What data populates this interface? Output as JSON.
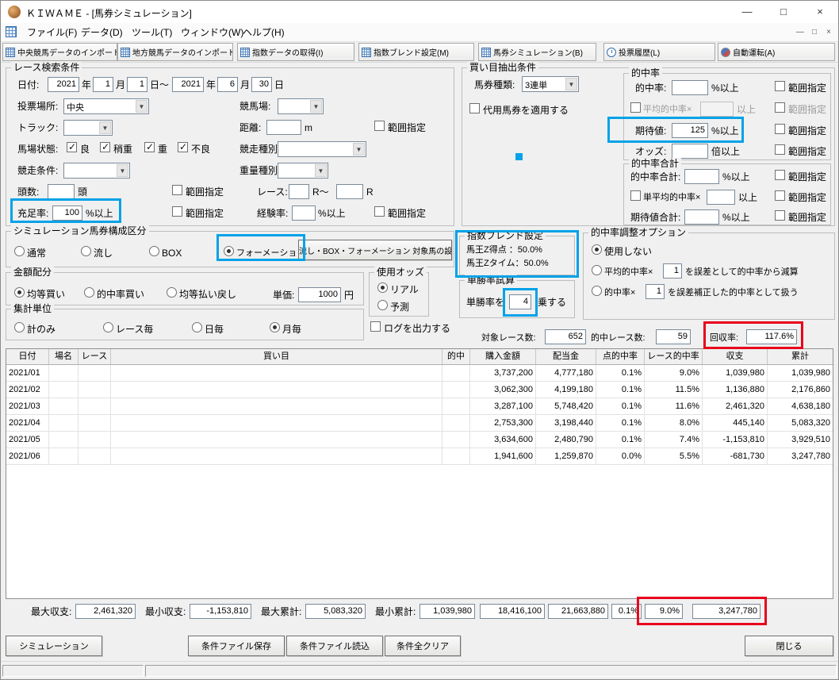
{
  "window": {
    "title": "ＫＩＷＡＭＥ - [馬券シミュレーション]",
    "minimize_glyph": "—",
    "maximize_glyph": "□",
    "close_glyph": "×"
  },
  "menu": {
    "file": "ファイル(F)",
    "data": "データ(D)",
    "tools": "ツール(T)",
    "window": "ウィンドウ(W)",
    "help": "ヘルプ(H)",
    "mdi_minimize": "—",
    "mdi_restore": "□",
    "mdi_close": "×"
  },
  "toolbar": {
    "central_import": "中央競馬データのインポート(J)",
    "local_import": "地方競馬データのインポート(N)",
    "index_fetch": "指数データの取得(I)",
    "index_blend": "指数ブレンド設定(M)",
    "simulation": "馬券シミュレーション(B)",
    "history": "投票履歴(L)",
    "autorun": "自動運転(A)"
  },
  "search": {
    "title": "レース検索条件",
    "date_label": "日付:",
    "from_year": "2021",
    "from_month": "1",
    "from_day": "1",
    "to_year": "2021",
    "to_month": "6",
    "to_day": "30",
    "year_unit": "年",
    "month_unit": "月",
    "day_range_unit": "日～",
    "day_unit": "日",
    "place_label": "投票場所:",
    "place_value": "中央",
    "course_label": "競馬場:",
    "track_label": "トラック:",
    "distance_label": "距離:",
    "distance_value": "",
    "distance_unit": "m",
    "range_label": "範囲指定",
    "going_label": "馬場状態:",
    "going_good": "良",
    "going_yielding": "稍重",
    "going_soft": "重",
    "going_heavy": "不良",
    "race_type_label": "競走種別:",
    "race_cond_label": "競走条件:",
    "weight_type_label": "重量種別:",
    "heads_label": "頭数:",
    "heads_value": "",
    "heads_unit": "頭",
    "race_no_label": "レース:",
    "race_no_from": "",
    "race_no_sep": "R～",
    "race_no_to": "",
    "race_no_unit": "R",
    "fill_label": "充足率:",
    "fill_value": "100",
    "fill_unit": "%以上",
    "exp_label": "経験率:",
    "exp_value": "",
    "exp_unit": "%以上"
  },
  "extract": {
    "title": "買い目抽出条件",
    "ticket_label": "馬券種類:",
    "ticket_value": "3連単",
    "substitute_label": "代用馬券を適用する",
    "hit_group": {
      "title": "的中率",
      "hit_label": "的中率:",
      "hit_value": "",
      "pct_unit": "%以上",
      "avg_label": "平均的中率×",
      "avg_value": "",
      "over_unit": "以上",
      "expect_label": "期待値:",
      "expect_value": "125",
      "odds_label": "オッズ:",
      "odds_value": "",
      "odds_unit": "倍以上",
      "range_label": "範囲指定"
    },
    "sum_group": {
      "title": "的中率合計",
      "hit_label": "的中率合計:",
      "hit_value": "",
      "avg_label": "単平均的中率×",
      "avg_value": "",
      "expect_label": "期待値合計:",
      "expect_value": "",
      "pct_unit": "%以上",
      "over_unit": "以上",
      "range_label": "範囲指定"
    }
  },
  "composition": {
    "title": "シミュレーション馬券構成区分",
    "normal": "通常",
    "nagashi": "流し",
    "box": "BOX",
    "formation": "フォーメーション",
    "selected": "フォーメーション",
    "target_button": "流し・BOX・フォーメーション 対象馬の設定"
  },
  "blend": {
    "title": "指数ブレンド設定",
    "line1": "馬王Z得点 ：50.0%",
    "line2": "馬王Zタイム：50.0%"
  },
  "winrate": {
    "title": "単勝率試算",
    "pre_label": "単勝率を",
    "value": "4",
    "post_label": "乗する"
  },
  "adjust": {
    "title": "的中率調整オプション",
    "none": "使用しない",
    "avg_pre": "平均的中率×",
    "avg_value": "1",
    "avg_post": "を誤差として的中率から減算",
    "hit_pre": "的中率×",
    "hit_value": "1",
    "hit_post": "を誤差補正した的中率として扱う",
    "selected": "使用しない"
  },
  "amount": {
    "title": "金額配分",
    "equal": "均等買い",
    "by_hit": "的中率買い",
    "equal_refund": "均等払い戻し",
    "selected": "均等買い",
    "unit_label": "単価:",
    "unit_value": "1000",
    "unit_suffix": "円"
  },
  "odds_source": {
    "title": "使用オッズ",
    "real": "リアル",
    "forecast": "予測",
    "selected": "リアル"
  },
  "aggregation": {
    "title": "集計単位",
    "total_only": "計のみ",
    "per_race": "レース毎",
    "per_day": "日毎",
    "per_month": "月毎",
    "selected": "月毎"
  },
  "log_checkbox_label": "ログを出力する",
  "stats": {
    "target_label": "対象レース数:",
    "target_value": "652",
    "hit_label": "的中レース数:",
    "hit_value": "59",
    "recovery_label": "回収率:",
    "recovery_value": "117.6%"
  },
  "table": {
    "headers": [
      "日付",
      "場名",
      "レース",
      "買い目",
      "的中",
      "購入金額",
      "配当金",
      "点的中率",
      "レース的中率",
      "収支",
      "累計"
    ],
    "rows": [
      [
        "2021/01",
        "",
        "",
        "",
        "",
        "3,737,200",
        "4,777,180",
        "0.1%",
        "9.0%",
        "1,039,980",
        "1,039,980"
      ],
      [
        "2021/02",
        "",
        "",
        "",
        "",
        "3,062,300",
        "4,199,180",
        "0.1%",
        "11.5%",
        "1,136,880",
        "2,176,860"
      ],
      [
        "2021/03",
        "",
        "",
        "",
        "",
        "3,287,100",
        "5,748,420",
        "0.1%",
        "11.6%",
        "2,461,320",
        "4,638,180"
      ],
      [
        "2021/04",
        "",
        "",
        "",
        "",
        "2,753,300",
        "3,198,440",
        "0.1%",
        "8.0%",
        "445,140",
        "5,083,320"
      ],
      [
        "2021/05",
        "",
        "",
        "",
        "",
        "3,634,600",
        "2,480,790",
        "0.1%",
        "7.4%",
        "-1,153,810",
        "3,929,510"
      ],
      [
        "2021/06",
        "",
        "",
        "",
        "",
        "1,941,600",
        "1,259,870",
        "0.0%",
        "5.5%",
        "-681,730",
        "3,247,780"
      ]
    ]
  },
  "summary": {
    "max_balance_label": "最大収支:",
    "max_balance": "2,461,320",
    "min_balance_label": "最小収支:",
    "min_balance": "-1,153,810",
    "max_total_label": "最大累計:",
    "max_total": "5,083,320",
    "min_total_label": "最小累計:",
    "min_total": "1,039,980",
    "purchase_total": "18,416,100",
    "payout_total": "21,663,880",
    "point_hit_total": "0.1%",
    "race_hit_total": "9.0%",
    "balance_total": "3,247,780"
  },
  "footer": {
    "simulate": "シミュレーション",
    "save": "条件ファイル保存",
    "load": "条件ファイル読込",
    "clear": "条件全クリア",
    "close": "閉じる"
  },
  "colors": {
    "annotation_blue": "#00a2e8",
    "annotation_red": "#e8001c"
  }
}
